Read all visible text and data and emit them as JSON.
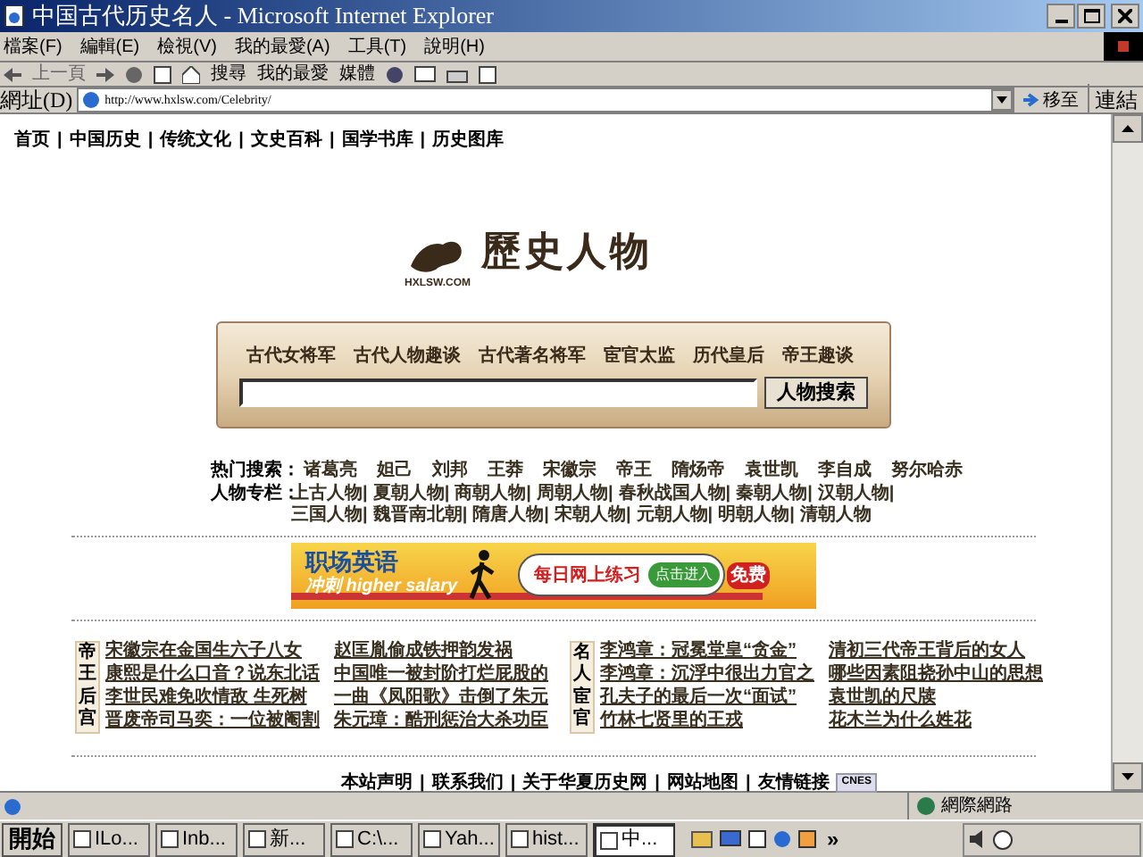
{
  "window": {
    "title": "中国古代历史名人 - Microsoft Internet Explorer"
  },
  "menu": [
    "檔案(F)",
    "編輯(E)",
    "檢視(V)",
    "我的最愛(A)",
    "工具(T)",
    "說明(H)"
  ],
  "toolbar": {
    "back": "上一頁",
    "search": "搜尋",
    "favorites": "我的最愛",
    "media": "媒體"
  },
  "address_bar": {
    "label": "網址(D)",
    "value": "http://www.hxlsw.com/Celebrity/",
    "go": "移至",
    "links": "連結"
  },
  "nav": {
    "separator": "|",
    "items": [
      "首页",
      "中国历史",
      "传统文化",
      "文史百科",
      "国学书库",
      "历史图库"
    ]
  },
  "logo": {
    "site": "HXLSW.COM",
    "title": "歷史人物"
  },
  "search_panel": {
    "tabs": [
      "古代女将军",
      "古代人物趣谈",
      "古代著名将军",
      "宦官太监",
      "历代皇后",
      "帝王趣谈"
    ],
    "button": "人物搜索"
  },
  "hot_search": {
    "label": "热门搜索：",
    "items": [
      "诸葛亮",
      "妲己",
      "刘邦",
      "王莽",
      "宋徽宗",
      "帝王",
      "隋炀帝",
      "袁世凯",
      "李自成",
      "努尔哈赤"
    ]
  },
  "columns": {
    "label": "人物专栏：",
    "items": [
      "上古人物|",
      "夏朝人物|",
      "商朝人物|",
      "周朝人物|",
      "春秋战国人物|",
      "秦朝人物|",
      "汉朝人物|",
      "三国人物|",
      "魏晋南北朝|",
      "隋唐人物|",
      "宋朝人物|",
      "元朝人物|",
      "明朝人物|",
      "清朝人物"
    ]
  },
  "banner": {
    "title": "职场英语",
    "slogan": "冲刺 higher salary",
    "bubble": "每日网上练习",
    "enter": "点击进入",
    "free": "免费"
  },
  "article_groups": [
    {
      "label": "帝王后宫",
      "links": [
        [
          "宋徽宗在金国生六子八女",
          "赵匡胤偷成铁押韵发祸"
        ],
        [
          "康熙是什么口音？说东北话",
          "中国唯一被封阶打烂屁股的"
        ],
        [
          "李世民难免吹情敌 生死树",
          "一曲《凤阳歌》击倒了朱元"
        ],
        [
          "晋废帝司马奕：一位被阉割",
          "朱元璋：酷刑惩治大杀功臣"
        ]
      ]
    },
    {
      "label": "名人宦官",
      "links": [
        [
          "李鸿章：冠冕堂皇“贪金”",
          "清初三代帝王背后的女人"
        ],
        [
          "李鸿章：沉浮中很出力官之",
          "哪些因素阻挠孙中山的思想"
        ],
        [
          "孔夫子的最后一次“面试”",
          "袁世凯的尺牍"
        ],
        [
          "竹林七贤里的王戎",
          "花木兰为什么姓花"
        ]
      ]
    }
  ],
  "footer": {
    "separator": "|",
    "items": [
      "本站声明",
      "联系我们",
      "关于华夏历史网",
      "网站地图",
      "友情链接"
    ],
    "badge": "CNES"
  },
  "status_bar": {
    "zone": "網際網路"
  },
  "taskbar": {
    "start": "開始",
    "tasks": [
      {
        "label": "ILo...",
        "selected": false
      },
      {
        "label": "Inb...",
        "selected": false
      },
      {
        "label": "新...",
        "selected": false
      },
      {
        "label": "C:\\...",
        "selected": false
      },
      {
        "label": "Yah...",
        "selected": false
      },
      {
        "label": "hist...",
        "selected": false
      },
      {
        "label": "中...",
        "selected": true
      }
    ],
    "chevron": "»"
  }
}
